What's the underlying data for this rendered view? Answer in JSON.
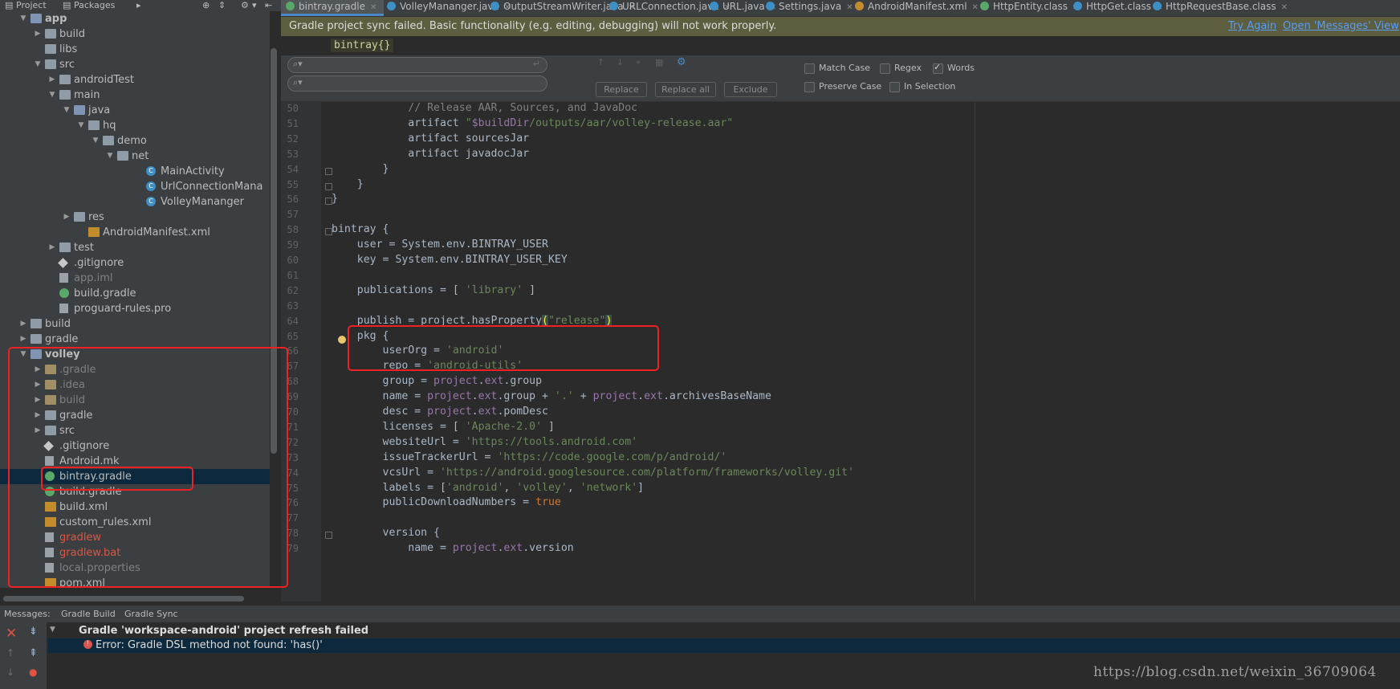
{
  "left_tabs": {
    "project": "Project",
    "packages": "Packages"
  },
  "tree": [
    {
      "label": "app",
      "depth": 1,
      "arrow": "open",
      "icon": "module",
      "bold": true
    },
    {
      "label": "build",
      "depth": 2,
      "arrow": "closed",
      "icon": "folder"
    },
    {
      "label": "libs",
      "depth": 2,
      "arrow": "none",
      "icon": "folder"
    },
    {
      "label": "src",
      "depth": 2,
      "arrow": "open",
      "icon": "folder"
    },
    {
      "label": "androidTest",
      "depth": 3,
      "arrow": "closed",
      "icon": "folder"
    },
    {
      "label": "main",
      "depth": 3,
      "arrow": "open",
      "icon": "folder"
    },
    {
      "label": "java",
      "depth": 4,
      "arrow": "open",
      "icon": "src-folder"
    },
    {
      "label": "hq",
      "depth": 5,
      "arrow": "open",
      "icon": "package"
    },
    {
      "label": "demo",
      "depth": 6,
      "arrow": "open",
      "icon": "package"
    },
    {
      "label": "net",
      "depth": 7,
      "arrow": "open",
      "icon": "package"
    },
    {
      "label": "MainActivity",
      "depth": 9,
      "arrow": "none",
      "icon": "class"
    },
    {
      "label": "UrlConnectionMana",
      "depth": 9,
      "arrow": "none",
      "icon": "class"
    },
    {
      "label": "VolleyMananger",
      "depth": 9,
      "arrow": "none",
      "icon": "class"
    },
    {
      "label": "res",
      "depth": 4,
      "arrow": "closed",
      "icon": "res-folder"
    },
    {
      "label": "AndroidManifest.xml",
      "depth": 5,
      "arrow": "none",
      "icon": "xml"
    },
    {
      "label": "test",
      "depth": 3,
      "arrow": "closed",
      "icon": "folder"
    },
    {
      "label": ".gitignore",
      "depth": 3,
      "arrow": "none",
      "icon": "git"
    },
    {
      "label": "app.iml",
      "depth": 3,
      "arrow": "none",
      "icon": "file",
      "style": "gray"
    },
    {
      "label": "build.gradle",
      "depth": 3,
      "arrow": "none",
      "icon": "gradle"
    },
    {
      "label": "proguard-rules.pro",
      "depth": 3,
      "arrow": "none",
      "icon": "file"
    },
    {
      "label": "build",
      "depth": 1,
      "arrow": "closed",
      "icon": "folder"
    },
    {
      "label": "gradle",
      "depth": 1,
      "arrow": "closed",
      "icon": "folder"
    },
    {
      "label": "volley",
      "depth": 1,
      "arrow": "open",
      "icon": "module",
      "bold": true
    },
    {
      "label": ".gradle",
      "depth": 2,
      "arrow": "closed",
      "icon": "excluded-folder",
      "style": "gray"
    },
    {
      "label": ".idea",
      "depth": 2,
      "arrow": "closed",
      "icon": "excluded-folder",
      "style": "gray"
    },
    {
      "label": "build",
      "depth": 2,
      "arrow": "closed",
      "icon": "excluded-folder",
      "style": "gray"
    },
    {
      "label": "gradle",
      "depth": 2,
      "arrow": "closed",
      "icon": "folder"
    },
    {
      "label": "src",
      "depth": 2,
      "arrow": "closed",
      "icon": "folder"
    },
    {
      "label": ".gitignore",
      "depth": 2,
      "arrow": "none",
      "icon": "git"
    },
    {
      "label": "Android.mk",
      "depth": 2,
      "arrow": "none",
      "icon": "file"
    },
    {
      "label": "bintray.gradle",
      "depth": 2,
      "arrow": "none",
      "icon": "gradle",
      "selected": true
    },
    {
      "label": "build.gradle",
      "depth": 2,
      "arrow": "none",
      "icon": "gradle"
    },
    {
      "label": "build.xml",
      "depth": 2,
      "arrow": "none",
      "icon": "xml"
    },
    {
      "label": "custom_rules.xml",
      "depth": 2,
      "arrow": "none",
      "icon": "xml"
    },
    {
      "label": "gradlew",
      "depth": 2,
      "arrow": "none",
      "icon": "file",
      "style": "red"
    },
    {
      "label": "gradlew.bat",
      "depth": 2,
      "arrow": "none",
      "icon": "file",
      "style": "red"
    },
    {
      "label": "local.properties",
      "depth": 2,
      "arrow": "none",
      "icon": "file",
      "style": "gray"
    },
    {
      "label": "pom.xml",
      "depth": 2,
      "arrow": "none",
      "icon": "xml"
    }
  ],
  "editor_tabs": [
    {
      "label": "bintray.gradle",
      "active": true,
      "icon": "gradle-icon",
      "color": "#59a869"
    },
    {
      "label": "VolleyMananger.java",
      "icon": "class-icon",
      "color": "#3d8fc6"
    },
    {
      "label": "OutputStreamWriter.java",
      "icon": "class-icon",
      "color": "#3d8fc6"
    },
    {
      "label": "URLConnection.java",
      "icon": "class-icon",
      "color": "#3d8fc6"
    },
    {
      "label": "URL.java",
      "icon": "class-icon",
      "color": "#3d8fc6"
    },
    {
      "label": "Settings.java",
      "icon": "class-icon",
      "color": "#3d8fc6"
    },
    {
      "label": "AndroidManifest.xml",
      "icon": "xml-icon",
      "color": "#c28c2c"
    },
    {
      "label": "HttpEntity.class",
      "icon": "interface-icon",
      "color": "#59a869"
    },
    {
      "label": "HttpGet.class",
      "icon": "class-icon",
      "color": "#3d8fc6"
    },
    {
      "label": "HttpRequestBase.class",
      "icon": "class-icon",
      "color": "#3d8fc6"
    }
  ],
  "banner": {
    "text": "Gradle project sync failed. Basic functionality (e.g. editing, debugging) will not work properly.",
    "try_again": "Try Again",
    "open_messages": "Open 'Messages' View"
  },
  "breadcrumb": "bintray{}",
  "search": {
    "find_value": "",
    "replace_value": "",
    "replace_label": "Replace",
    "replace_all_label": "Replace all",
    "exclude_label": "Exclude",
    "match_case": "Match Case",
    "regex": "Regex",
    "words": "Words",
    "preserve_case": "Preserve Case",
    "in_selection": "In Selection"
  },
  "code_lines": [
    {
      "n": "50",
      "html": "            <span class=\"cmt\">// Release AAR, Sources, and JavaDoc</span>"
    },
    {
      "n": "51",
      "html": "            artifact <span class=\"str\">\"</span><span class=\"prp\">$buildDir</span><span class=\"str\">/outputs/aar/volley-release.aar\"</span>"
    },
    {
      "n": "52",
      "html": "            artifact sourcesJar"
    },
    {
      "n": "53",
      "html": "            artifact javadocJar"
    },
    {
      "n": "54",
      "html": "        }"
    },
    {
      "n": "55",
      "html": "    }"
    },
    {
      "n": "56",
      "html": "}"
    },
    {
      "n": "57",
      "html": ""
    },
    {
      "n": "58",
      "html": "bintray {"
    },
    {
      "n": "59",
      "html": "    user = System.env.BINTRAY_USER"
    },
    {
      "n": "60",
      "html": "    key = System.env.BINTRAY_USER_KEY"
    },
    {
      "n": "61",
      "html": ""
    },
    {
      "n": "62",
      "html": "    publications = [ <span class=\"str\">'library'</span> ]"
    },
    {
      "n": "63",
      "html": ""
    },
    {
      "n": "64",
      "html": "    publish = project.hasProperty<span style=\"color:#ffef28;background:#3b514d\">(</span><span class=\"str\">\"release\"</span><span style=\"color:#ffef28;background:#3b514d\">)</span>"
    },
    {
      "n": "65",
      "html": "    pkg {"
    },
    {
      "n": "66",
      "html": "        userOrg = <span class=\"str\">'android'</span>"
    },
    {
      "n": "67",
      "html": "        repo = <span class=\"str\">'android-utils'</span>"
    },
    {
      "n": "68",
      "html": "        group = <span class=\"prp\">project</span>.<span class=\"prp\">ext</span>.group"
    },
    {
      "n": "69",
      "html": "        name = <span class=\"prp\">project</span>.<span class=\"prp\">ext</span>.group + <span class=\"str\">'.'</span> + <span class=\"prp\">project</span>.<span class=\"prp\">ext</span>.archivesBaseName"
    },
    {
      "n": "70",
      "html": "        desc = <span class=\"prp\">project</span>.<span class=\"prp\">ext</span>.pomDesc"
    },
    {
      "n": "71",
      "html": "        licenses = [ <span class=\"str\">'Apache-2.0'</span> ]"
    },
    {
      "n": "72",
      "html": "        websiteUrl = <span class=\"str\">'https://tools.android.com'</span>"
    },
    {
      "n": "73",
      "html": "        issueTrackerUrl = <span class=\"str\">'https://code.google.com/p/android/'</span>"
    },
    {
      "n": "74",
      "html": "        vcsUrl = <span class=\"str\">'https://android.googlesource.com/platform/frameworks/volley.git'</span>"
    },
    {
      "n": "75",
      "html": "        labels = [<span class=\"str\">'android'</span>, <span class=\"str\">'volley'</span>, <span class=\"str\">'network'</span>]"
    },
    {
      "n": "76",
      "html": "        publicDownloadNumbers = <span class=\"kw\">true</span>"
    },
    {
      "n": "77",
      "html": ""
    },
    {
      "n": "78",
      "html": "        version {"
    },
    {
      "n": "79",
      "html": "            name = <span class=\"prp\">project</span>.<span class=\"prp\">ext</span>.version"
    }
  ],
  "messages": {
    "label": "Messages:",
    "tab_build": "Gradle Build",
    "tab_sync": "Gradle Sync",
    "title": "Gradle 'workspace-android' project refresh failed",
    "error": "Error: Gradle DSL method not found: 'has()'"
  },
  "watermark": "https://blog.csdn.net/weixin_36709064",
  "colors": {
    "accent": "#4a88c7",
    "banner": "#5d5d3f",
    "highlight_box": "#ee2222",
    "error": "#e0543f"
  }
}
